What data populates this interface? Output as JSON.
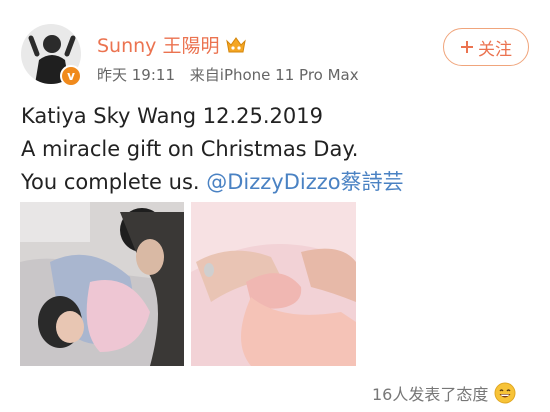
{
  "author": {
    "name": "Sunny 王陽明",
    "time": "昨天 19:11",
    "source": "来自iPhone 11 Pro Max",
    "verified_badge": "v"
  },
  "follow_button": {
    "label": "关注",
    "icon": "plus-icon"
  },
  "post": {
    "line1": "Katiya Sky Wang 12.25.2019",
    "line2": "A miracle gift on Christmas Day.",
    "line3_prefix": "You complete us.",
    "line3_mention": "@DizzyDizzo蔡詩芸"
  },
  "reactions": {
    "text": "16人发表了态度",
    "icon": "grinning-face-icon"
  },
  "colors": {
    "accent": "#eb7350",
    "link": "#4a82c3",
    "verified": "#f08a1c"
  }
}
